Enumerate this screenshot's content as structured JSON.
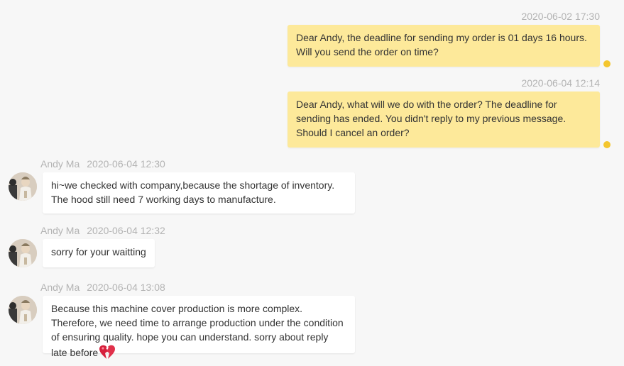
{
  "messages": [
    {
      "direction": "outgoing",
      "timestamp": "2020-06-02 17:30",
      "text": "Dear Andy, the deadline for sending my order is 01 days 16 hours. Will you send the order on time?",
      "status": "unread-dot"
    },
    {
      "direction": "outgoing",
      "timestamp": "2020-06-04 12:14",
      "text": "Dear Andy, what will we do with the order? The deadline for sending has ended. You didn't reply to my previous message. Should I cancel an order?",
      "status": "unread-dot"
    },
    {
      "direction": "incoming",
      "sender": "Andy Ma",
      "timestamp": "2020-06-04 12:30",
      "text": "hi~we checked with company,because the shortage of inventory. The hood still need 7 working days to manufacture."
    },
    {
      "direction": "incoming",
      "sender": "Andy Ma",
      "timestamp": "2020-06-04 12:32",
      "text": "sorry for your waitting"
    },
    {
      "direction": "incoming",
      "sender": "Andy Ma",
      "timestamp": "2020-06-04 13:08",
      "text": "Because this machine cover production is more complex. Therefore, we need time to arrange production under the condition of ensuring quality. hope you can understand. sorry about reply late before",
      "emoji": "broken-heart-icon"
    }
  ],
  "colors": {
    "outgoing_bubble": "#fde99a",
    "incoming_bubble": "#ffffff",
    "status_dot": "#f4c62f",
    "meta_text": "#b3b3b3",
    "background": "#f7f7f7"
  }
}
